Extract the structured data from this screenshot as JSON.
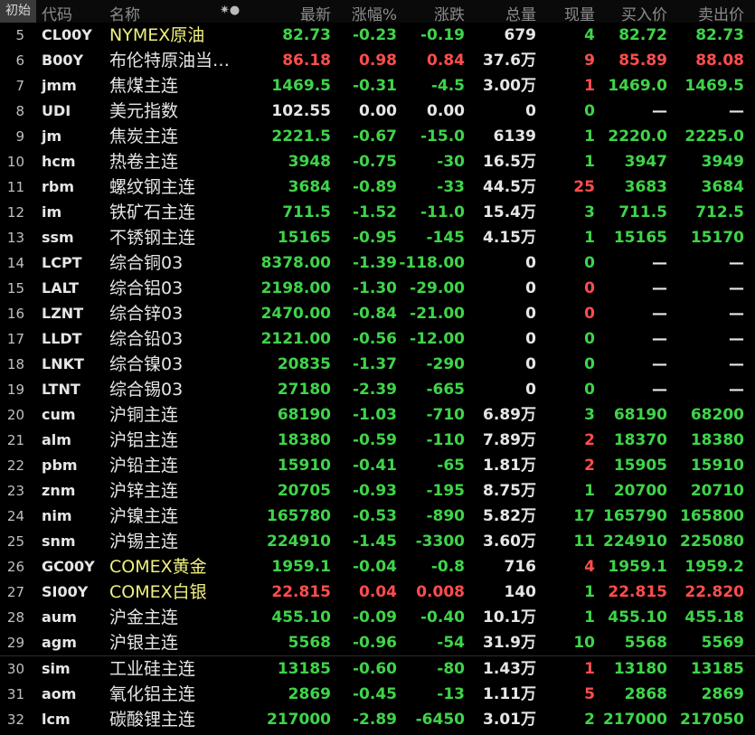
{
  "header": {
    "init_button": "初始",
    "col_code": "代码",
    "col_name": "名称",
    "col_settings_glyph": "✷●",
    "col_last": "最新",
    "col_pct": "涨幅%",
    "col_change": "涨跌",
    "col_volume": "总量",
    "col_current": "现量",
    "col_bid": "买入价",
    "col_ask": "卖出价"
  },
  "colors": {
    "up": "#ff4d4d",
    "down": "#3fd44a",
    "flat": "#e6e6e6",
    "highlight_name": "#f0f080"
  },
  "rows": [
    {
      "idx": "5",
      "code": "CL00Y",
      "name": "NYMEX原油",
      "hl": true,
      "last": "82.73",
      "pct": "-0.23",
      "chg": "-0.19",
      "vol": "679",
      "cur": "4",
      "bid": "82.72",
      "ask": "82.73",
      "dir": "g",
      "cdir": "g"
    },
    {
      "idx": "6",
      "code": "B00Y",
      "name": "布伦特原油当…",
      "hl": false,
      "last": "86.18",
      "pct": "0.98",
      "chg": "0.84",
      "vol": "37.6万",
      "cur": "9",
      "bid": "85.89",
      "ask": "88.08",
      "dir": "r",
      "cdir": "r"
    },
    {
      "idx": "7",
      "code": "jmm",
      "name": "焦煤主连",
      "hl": false,
      "last": "1469.5",
      "pct": "-0.31",
      "chg": "-4.5",
      "vol": "3.00万",
      "cur": "1",
      "bid": "1469.0",
      "ask": "1469.5",
      "dir": "g",
      "cdir": "r"
    },
    {
      "idx": "8",
      "code": "UDI",
      "name": "美元指数",
      "hl": false,
      "last": "102.55",
      "pct": "0.00",
      "chg": "0.00",
      "vol": "0",
      "cur": "0",
      "bid": "—",
      "ask": "—",
      "dir": "w",
      "cdir": "g"
    },
    {
      "idx": "9",
      "code": "jm",
      "name": "焦炭主连",
      "hl": false,
      "last": "2221.5",
      "pct": "-0.67",
      "chg": "-15.0",
      "vol": "6139",
      "cur": "1",
      "bid": "2220.0",
      "ask": "2225.0",
      "dir": "g",
      "cdir": "g"
    },
    {
      "idx": "10",
      "code": "hcm",
      "name": "热卷主连",
      "hl": false,
      "last": "3948",
      "pct": "-0.75",
      "chg": "-30",
      "vol": "16.5万",
      "cur": "1",
      "bid": "3947",
      "ask": "3949",
      "dir": "g",
      "cdir": "g"
    },
    {
      "idx": "11",
      "code": "rbm",
      "name": "螺纹钢主连",
      "hl": false,
      "last": "3684",
      "pct": "-0.89",
      "chg": "-33",
      "vol": "44.5万",
      "cur": "25",
      "bid": "3683",
      "ask": "3684",
      "dir": "g",
      "cdir": "r"
    },
    {
      "idx": "12",
      "code": "im",
      "name": "铁矿石主连",
      "hl": false,
      "last": "711.5",
      "pct": "-1.52",
      "chg": "-11.0",
      "vol": "15.4万",
      "cur": "3",
      "bid": "711.5",
      "ask": "712.5",
      "dir": "g",
      "cdir": "g"
    },
    {
      "idx": "13",
      "code": "ssm",
      "name": "不锈钢主连",
      "hl": false,
      "last": "15165",
      "pct": "-0.95",
      "chg": "-145",
      "vol": "4.15万",
      "cur": "1",
      "bid": "15165",
      "ask": "15170",
      "dir": "g",
      "cdir": "g"
    },
    {
      "idx": "14",
      "code": "LCPT",
      "name": "综合铜03",
      "hl": false,
      "last": "8378.00",
      "pct": "-1.39",
      "chg": "-118.00",
      "vol": "0",
      "cur": "0",
      "bid": "—",
      "ask": "—",
      "dir": "g",
      "cdir": "g"
    },
    {
      "idx": "15",
      "code": "LALT",
      "name": "综合铝03",
      "hl": false,
      "last": "2198.00",
      "pct": "-1.30",
      "chg": "-29.00",
      "vol": "0",
      "cur": "0",
      "bid": "—",
      "ask": "—",
      "dir": "g",
      "cdir": "r"
    },
    {
      "idx": "16",
      "code": "LZNT",
      "name": "综合锌03",
      "hl": false,
      "last": "2470.00",
      "pct": "-0.84",
      "chg": "-21.00",
      "vol": "0",
      "cur": "0",
      "bid": "—",
      "ask": "—",
      "dir": "g",
      "cdir": "r"
    },
    {
      "idx": "17",
      "code": "LLDT",
      "name": "综合铅03",
      "hl": false,
      "last": "2121.00",
      "pct": "-0.56",
      "chg": "-12.00",
      "vol": "0",
      "cur": "0",
      "bid": "—",
      "ask": "—",
      "dir": "g",
      "cdir": "g"
    },
    {
      "idx": "18",
      "code": "LNKT",
      "name": "综合镍03",
      "hl": false,
      "last": "20835",
      "pct": "-1.37",
      "chg": "-290",
      "vol": "0",
      "cur": "0",
      "bid": "—",
      "ask": "—",
      "dir": "g",
      "cdir": "g"
    },
    {
      "idx": "19",
      "code": "LTNT",
      "name": "综合锡03",
      "hl": false,
      "last": "27180",
      "pct": "-2.39",
      "chg": "-665",
      "vol": "0",
      "cur": "0",
      "bid": "—",
      "ask": "—",
      "dir": "g",
      "cdir": "g"
    },
    {
      "idx": "20",
      "code": "cum",
      "name": "沪铜主连",
      "hl": false,
      "last": "68190",
      "pct": "-1.03",
      "chg": "-710",
      "vol": "6.89万",
      "cur": "3",
      "bid": "68190",
      "ask": "68200",
      "dir": "g",
      "cdir": "g"
    },
    {
      "idx": "21",
      "code": "alm",
      "name": "沪铝主连",
      "hl": false,
      "last": "18380",
      "pct": "-0.59",
      "chg": "-110",
      "vol": "7.89万",
      "cur": "2",
      "bid": "18370",
      "ask": "18380",
      "dir": "g",
      "cdir": "r"
    },
    {
      "idx": "22",
      "code": "pbm",
      "name": "沪铅主连",
      "hl": false,
      "last": "15910",
      "pct": "-0.41",
      "chg": "-65",
      "vol": "1.81万",
      "cur": "2",
      "bid": "15905",
      "ask": "15910",
      "dir": "g",
      "cdir": "r"
    },
    {
      "idx": "23",
      "code": "znm",
      "name": "沪锌主连",
      "hl": false,
      "last": "20705",
      "pct": "-0.93",
      "chg": "-195",
      "vol": "8.75万",
      "cur": "1",
      "bid": "20700",
      "ask": "20710",
      "dir": "g",
      "cdir": "g"
    },
    {
      "idx": "24",
      "code": "nim",
      "name": "沪镍主连",
      "hl": false,
      "last": "165780",
      "pct": "-0.53",
      "chg": "-890",
      "vol": "5.82万",
      "cur": "17",
      "bid": "165790",
      "ask": "165800",
      "dir": "g",
      "cdir": "g"
    },
    {
      "idx": "25",
      "code": "snm",
      "name": "沪锡主连",
      "hl": false,
      "last": "224910",
      "pct": "-1.45",
      "chg": "-3300",
      "vol": "3.60万",
      "cur": "11",
      "bid": "224910",
      "ask": "225080",
      "dir": "g",
      "cdir": "g"
    },
    {
      "idx": "26",
      "code": "GC00Y",
      "name": "COMEX黄金",
      "hl": true,
      "last": "1959.1",
      "pct": "-0.04",
      "chg": "-0.8",
      "vol": "716",
      "cur": "4",
      "bid": "1959.1",
      "ask": "1959.2",
      "dir": "g",
      "cdir": "r"
    },
    {
      "idx": "27",
      "code": "SI00Y",
      "name": "COMEX白银",
      "hl": true,
      "last": "22.815",
      "pct": "0.04",
      "chg": "0.008",
      "vol": "140",
      "cur": "1",
      "bid": "22.815",
      "ask": "22.820",
      "dir": "r",
      "cdir": "g"
    },
    {
      "idx": "28",
      "code": "aum",
      "name": "沪金主连",
      "hl": false,
      "last": "455.10",
      "pct": "-0.09",
      "chg": "-0.40",
      "vol": "10.1万",
      "cur": "1",
      "bid": "455.10",
      "ask": "455.18",
      "dir": "g",
      "cdir": "g"
    },
    {
      "idx": "29",
      "code": "agm",
      "name": "沪银主连",
      "hl": false,
      "last": "5568",
      "pct": "-0.96",
      "chg": "-54",
      "vol": "31.9万",
      "cur": "10",
      "bid": "5568",
      "ask": "5569",
      "dir": "g",
      "cdir": "g"
    },
    {
      "idx": "30",
      "code": "sim",
      "name": "工业硅主连",
      "hl": false,
      "last": "13185",
      "pct": "-0.60",
      "chg": "-80",
      "vol": "1.43万",
      "cur": "1",
      "bid": "13180",
      "ask": "13185",
      "dir": "g",
      "cdir": "r"
    },
    {
      "idx": "31",
      "code": "aom",
      "name": "氧化铝主连",
      "hl": false,
      "last": "2869",
      "pct": "-0.45",
      "chg": "-13",
      "vol": "1.11万",
      "cur": "5",
      "bid": "2868",
      "ask": "2869",
      "dir": "g",
      "cdir": "r"
    },
    {
      "idx": "32",
      "code": "lcm",
      "name": "碳酸锂主连",
      "hl": false,
      "last": "217000",
      "pct": "-2.89",
      "chg": "-6450",
      "vol": "3.01万",
      "cur": "2",
      "bid": "217000",
      "ask": "217050",
      "dir": "g",
      "cdir": "g"
    }
  ]
}
